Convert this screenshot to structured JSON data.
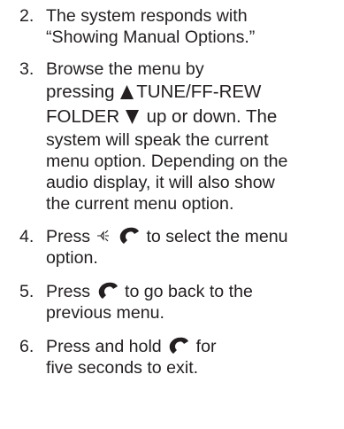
{
  "steps": [
    {
      "number": "2.",
      "line1": "The system responds with",
      "line2": "“Showing Manual Options.”"
    },
    {
      "number": "3.",
      "line1": "Browse the menu by",
      "line2a": "pressing",
      "line2b": "TUNE/FF-REW",
      "line3a": "FOLDER",
      "line3b": "up or down. The",
      "line4": "system will speak the current",
      "line5": "menu option. Depending on the",
      "line6": "audio display, it will also show",
      "line7": "the current menu option."
    },
    {
      "number": "4.",
      "line1a": "Press",
      "line1b": "to select the menu",
      "line2": "option."
    },
    {
      "number": "5.",
      "line1a": "Press",
      "line1b": "to go back to the",
      "line2": "previous menu."
    },
    {
      "number": "6.",
      "line1a": "Press and hold",
      "line1b": "for",
      "line2": "five seconds to exit."
    }
  ],
  "icons": {
    "up": "up-triangle-icon",
    "down": "down-triangle-icon",
    "voice": "voice-recognition-icon",
    "phone": "phone-icon"
  },
  "colors": {
    "text": "#231f20"
  }
}
